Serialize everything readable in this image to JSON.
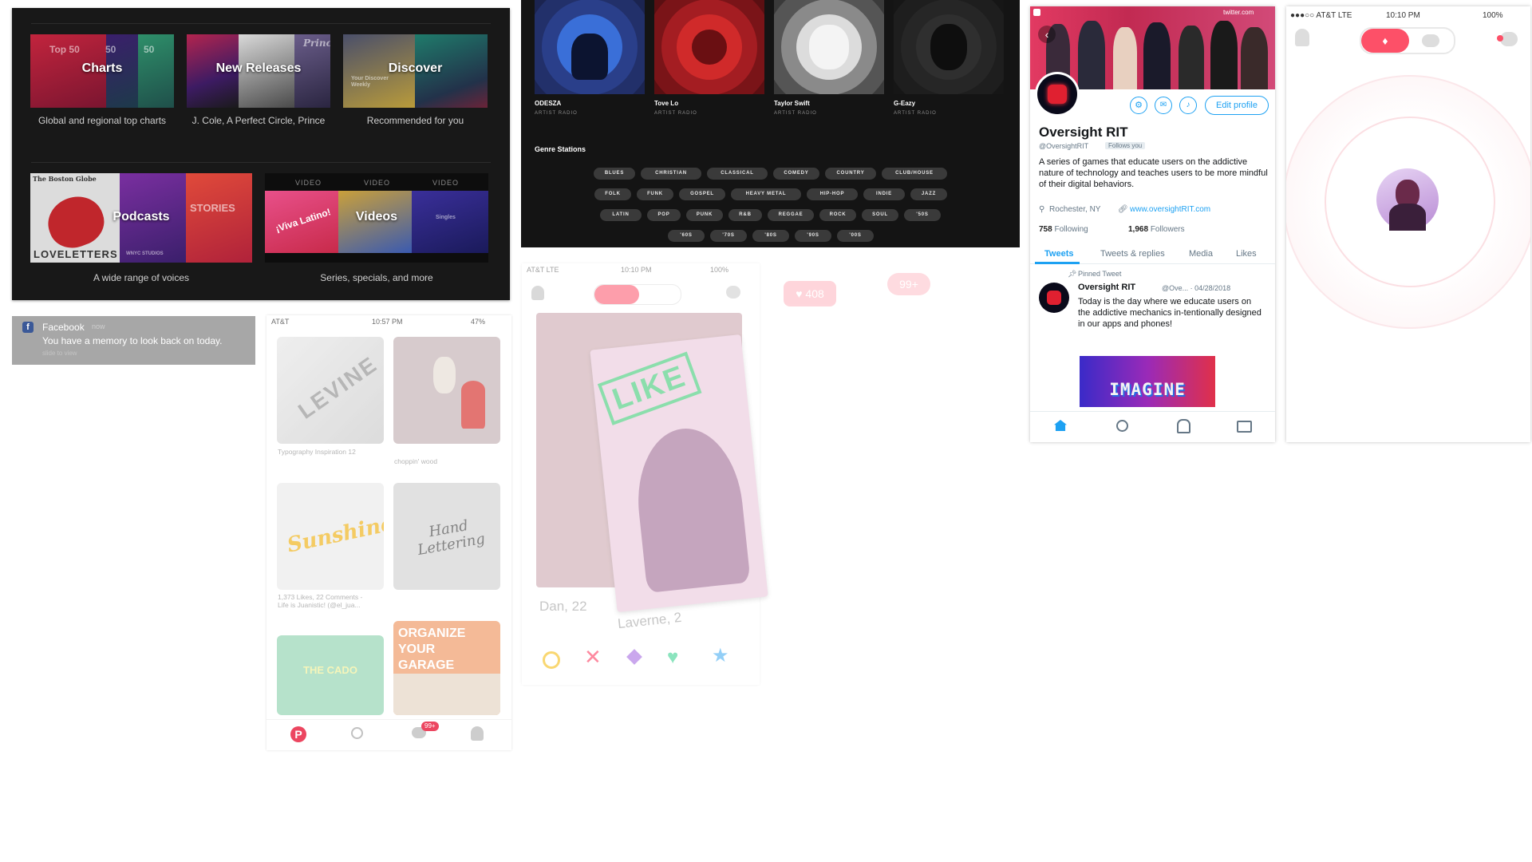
{
  "spotify": {
    "tiles": [
      {
        "title": "Charts",
        "caption": "Global and regional top charts",
        "art_text": [
          "Top 50",
          "50",
          "50"
        ]
      },
      {
        "title": "New Releases",
        "caption": "J. Cole, A Perfect Circle, Prince",
        "art_text": [
          "Prince"
        ]
      },
      {
        "title": "Discover",
        "caption": "Recommended for you",
        "art_text": [
          "Your Discover Weekly"
        ]
      },
      {
        "title": "Podcasts",
        "caption": "A wide range of voices",
        "art_text": [
          "The Boston Globe",
          "LOVELETTERS",
          "STORIES",
          "WNYC STUDIOS"
        ]
      },
      {
        "title": "Videos",
        "caption": "Series, specials, and more",
        "art_text": [
          "VIDEO",
          "VIDEO",
          "VIDEO",
          "¡Viva Latino!",
          "Singles"
        ]
      }
    ]
  },
  "radio": {
    "artists": [
      {
        "name": "ODESZA",
        "sub": "ARTIST RADIO",
        "color": "#3a6fd8"
      },
      {
        "name": "Tove Lo",
        "sub": "ARTIST RADIO",
        "color": "#d02a2a"
      },
      {
        "name": "Taylor Swift",
        "sub": "ARTIST RADIO",
        "color": "#9a9a9a"
      },
      {
        "name": "G-Eazy",
        "sub": "ARTIST RADIO",
        "color": "#3a3a3a"
      }
    ],
    "genre_heading": "Genre Stations",
    "genres": [
      [
        "BLUES",
        "CHRISTIAN",
        "CLASSICAL",
        "COMEDY",
        "COUNTRY",
        "CLUB/HOUSE"
      ],
      [
        "FOLK",
        "FUNK",
        "GOSPEL",
        "HEAVY METAL",
        "HIP-HOP",
        "INDIE",
        "JAZZ"
      ],
      [
        "LATIN",
        "POP",
        "PUNK",
        "R&B",
        "REGGAE",
        "ROCK",
        "SOUL",
        "'50S"
      ],
      [
        "'60S",
        "'70S",
        "'80S",
        "'90S",
        "'00S"
      ]
    ]
  },
  "facebook": {
    "app": "Facebook",
    "time": "now",
    "message": "You have a memory to look back on today.",
    "action": "slide to view"
  },
  "pinterest": {
    "status": {
      "carrier": "AT&T",
      "time": "10:57 PM",
      "battery": "47%"
    },
    "pins": [
      {
        "caption": "Typography Inspiration 12",
        "art": "LEVINE"
      },
      {
        "caption": "choppin' wood",
        "art": ""
      },
      {
        "caption": "1,373 Likes, 22 Comments - Life is Juanistic! (@el_jua...",
        "art": "Sunshine"
      },
      {
        "caption": "",
        "art": "Hand Lettering"
      },
      {
        "caption": "",
        "art": "THE CADO"
      },
      {
        "caption": "",
        "art": "ORGANIZE YOUR GARAGE"
      }
    ],
    "badge": "99+"
  },
  "tinder_swipe": {
    "status": {
      "carrier": "AT&T LTE",
      "time": "10:10 PM",
      "battery": "100%"
    },
    "stamp": "LIKE",
    "card_back": "Dan, 22",
    "card_front": "Laverne, 2",
    "floating_likes": "408",
    "floating_badge": "99+"
  },
  "twitter": {
    "url": "twitter.com",
    "name": "Oversight RIT",
    "handle": "@OversightRIT",
    "follows_you": "Follows you",
    "edit_profile": "Edit profile",
    "bio": "A series of games that educate users on the addictive nature of technology and teaches users to be more mindful of their digital behaviors.",
    "location": "Rochester, NY",
    "website": "www.oversightRIT.com",
    "following_count": "758",
    "following_label": "Following",
    "followers_count": "1,968",
    "followers_label": "Followers",
    "tabs": [
      "Tweets",
      "Tweets & replies",
      "Media",
      "Likes"
    ],
    "pinned_label": "Pinned Tweet",
    "tweet_name": "Oversight RIT",
    "tweet_handle_date": "@Ove... · 04/28/2018",
    "tweet_text": "Today is the day where we educate users on the addictive mechanics in-tentionally designed in our apps and phones!",
    "tweet_image_text": "IMAGINE",
    "accent": "#1da1f2"
  },
  "tinder_radar": {
    "status": {
      "carrier": "●●●○○ AT&T LTE",
      "time": "10:10 PM",
      "battery": "100%"
    },
    "accent": "#fd5068"
  }
}
